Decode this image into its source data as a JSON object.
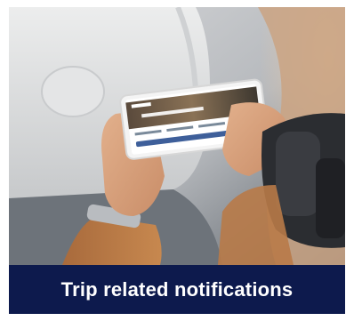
{
  "card": {
    "caption": "Trip related notifications",
    "caption_bg_color": "#0d1a4d",
    "caption_text_color": "#ffffff"
  }
}
